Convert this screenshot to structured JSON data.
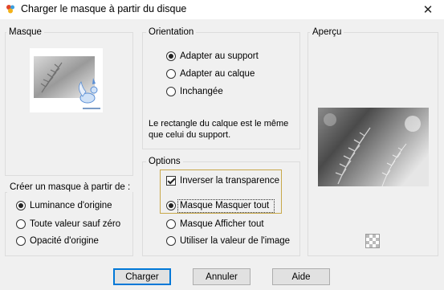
{
  "window": {
    "title": "Charger le masque à partir du disque",
    "close_glyph": "✕"
  },
  "masque_group": {
    "label": "Masque"
  },
  "create_group": {
    "label": "Créer un masque à partir de :",
    "options": [
      {
        "label": "Luminance d'origine",
        "checked": true
      },
      {
        "label": "Toute valeur sauf zéro",
        "checked": false
      },
      {
        "label": "Opacité d'origine",
        "checked": false
      }
    ]
  },
  "orientation_group": {
    "label": "Orientation",
    "options": [
      {
        "label": "Adapter au support",
        "checked": true
      },
      {
        "label": "Adapter au calque",
        "checked": false
      },
      {
        "label": "Inchangée",
        "checked": false
      }
    ],
    "note": "Le rectangle du calque est le même que celui du support."
  },
  "options_group": {
    "label": "Options",
    "invert_label": "Inverser la transparence",
    "invert_checked": true,
    "options": [
      {
        "label": "Masque Masquer tout",
        "checked": true
      },
      {
        "label": "Masque Afficher tout",
        "checked": false
      },
      {
        "label": "Utiliser la valeur de l'image",
        "checked": false
      }
    ]
  },
  "preview_group": {
    "label": "Aperçu"
  },
  "buttons": {
    "load": "Charger",
    "cancel": "Annuler",
    "help": "Aide"
  },
  "colors": {
    "accent": "#0078d7",
    "highlight_border": "#c8a84a"
  }
}
